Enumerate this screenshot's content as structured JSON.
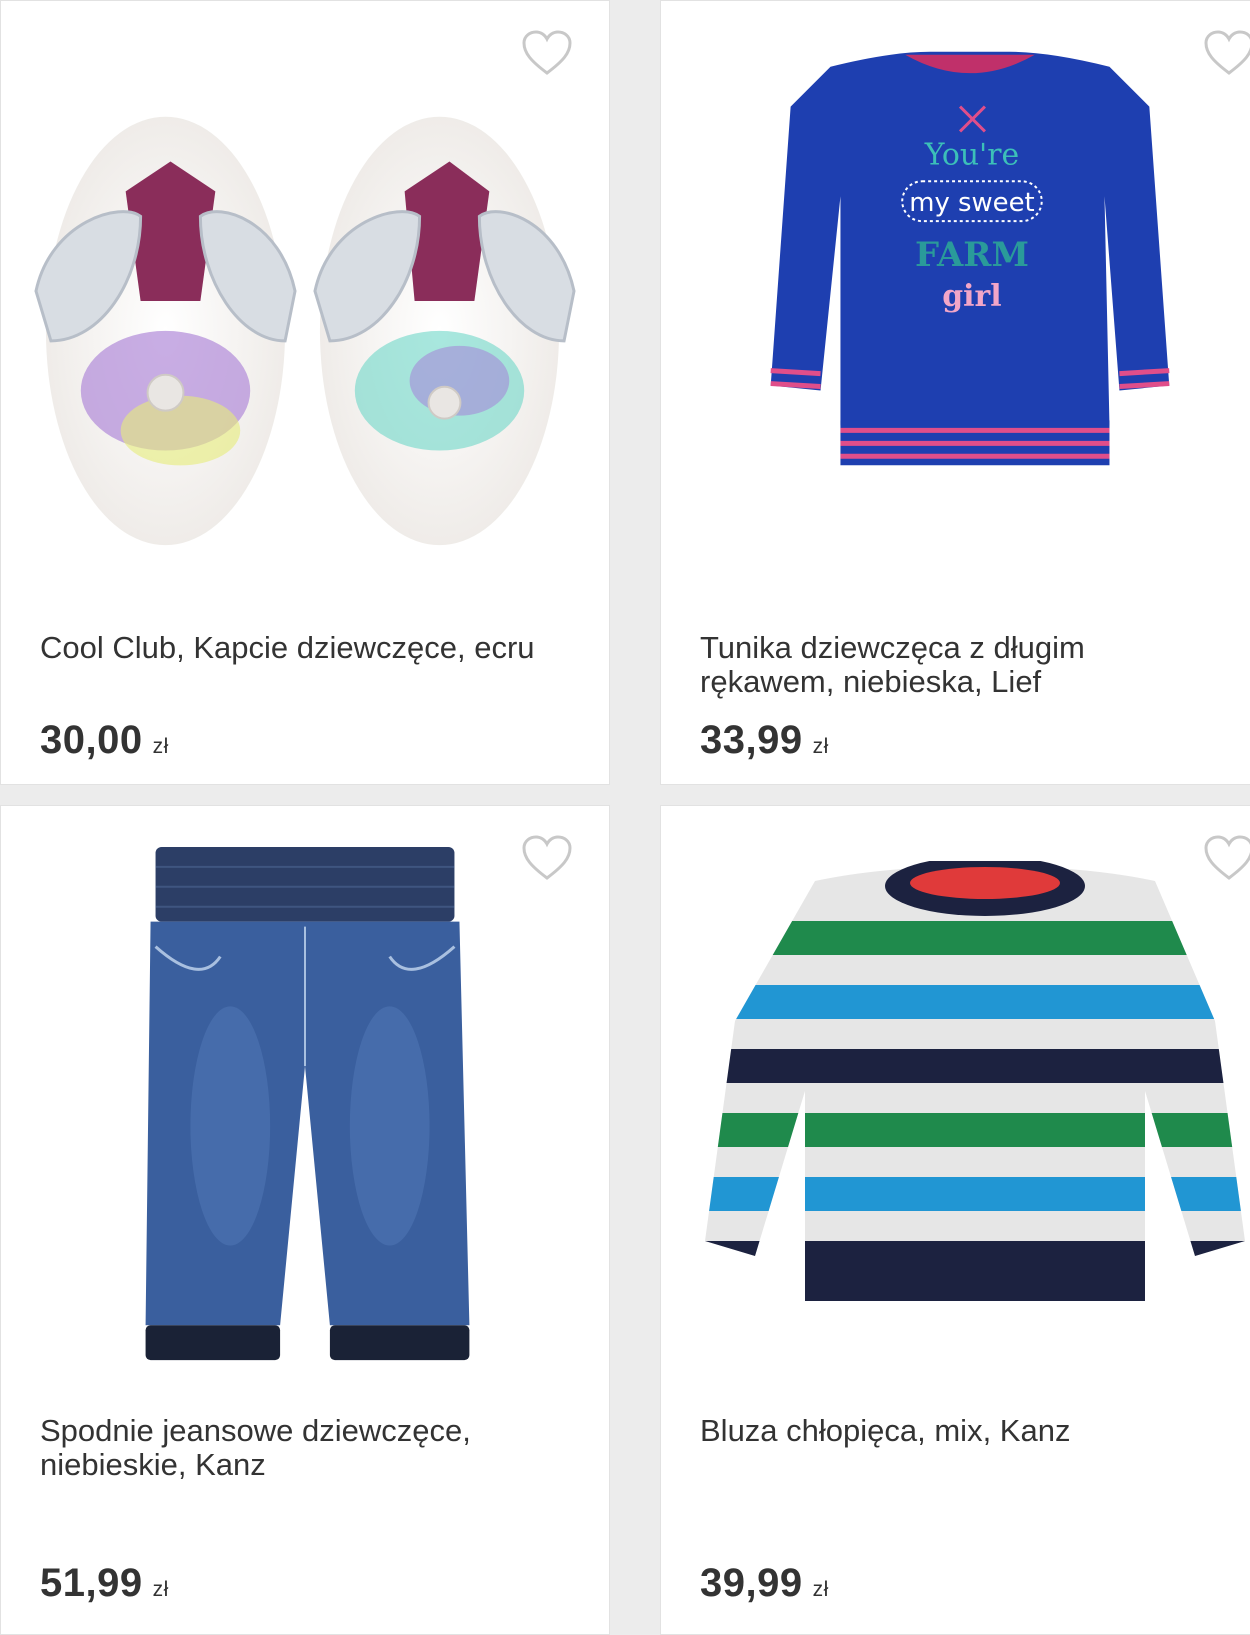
{
  "products": [
    {
      "title": "Cool Club, Kapcie dziewczęce, ecru",
      "price": "30,00",
      "currency": "zł",
      "image_icon": "slippers-image",
      "favorite_icon": "heart-outline-icon"
    },
    {
      "title": "Tunika dziewczęca z długim rękawem, niebieska, Lief",
      "price": "33,99",
      "currency": "zł",
      "image_icon": "blue-sweatshirt-image",
      "favorite_icon": "heart-outline-icon",
      "print_text": [
        "You're",
        "my sweet",
        "FARM",
        "girl"
      ]
    },
    {
      "title": "Spodnie jeansowe dziewczęce, niebieskie, Kanz",
      "price": "51,99",
      "currency": "zł",
      "image_icon": "jeans-image",
      "favorite_icon": "heart-outline-icon"
    },
    {
      "title": "Bluza chłopięca, mix, Kanz",
      "price": "39,99",
      "currency": "zł",
      "image_icon": "striped-sweatshirt-image",
      "favorite_icon": "heart-outline-icon"
    }
  ],
  "colors": {
    "background": "#ececec",
    "card": "#ffffff",
    "text": "#333333",
    "heart": "#c8c8c8"
  }
}
